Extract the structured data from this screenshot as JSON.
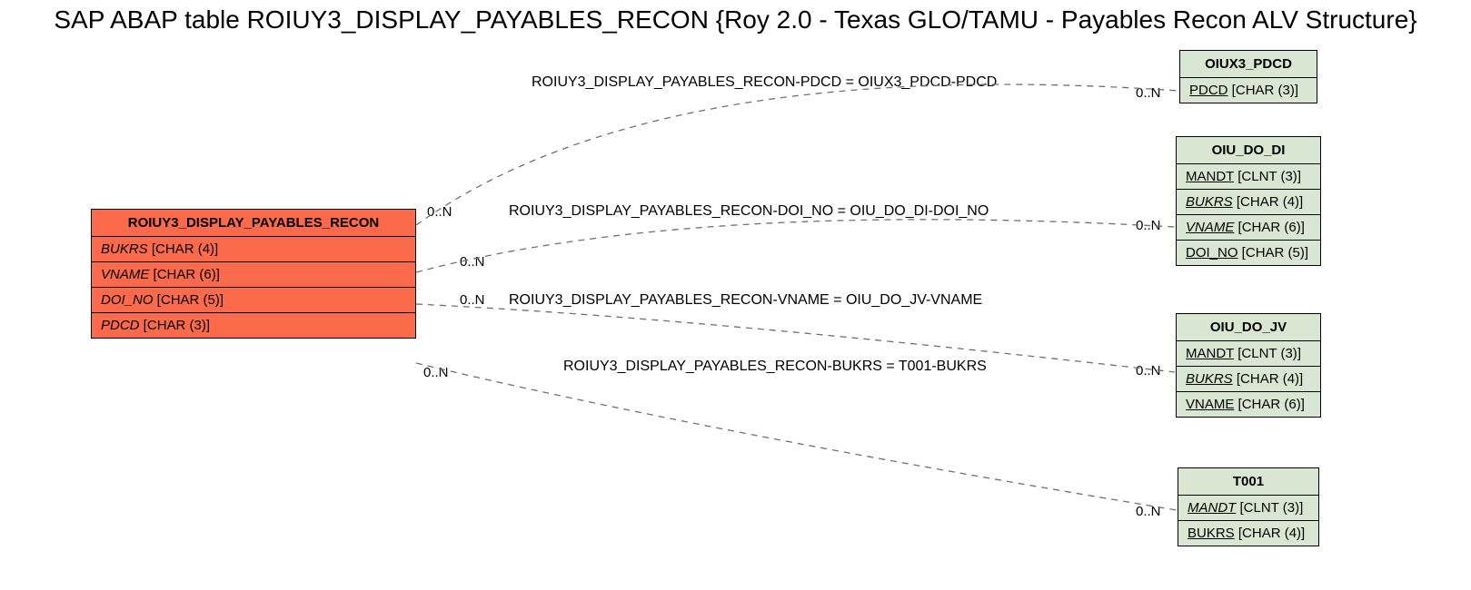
{
  "title": "SAP ABAP table ROIUY3_DISPLAY_PAYABLES_RECON {Roy 2.0 - Texas GLO/TAMU - Payables Recon ALV Structure}",
  "main_table": {
    "name": "ROIUY3_DISPLAY_PAYABLES_RECON",
    "fields": [
      {
        "name": "BUKRS",
        "type": "CHAR (4)",
        "italic": true
      },
      {
        "name": "VNAME",
        "type": "CHAR (6)",
        "italic": true
      },
      {
        "name": "DOI_NO",
        "type": "CHAR (5)",
        "italic": true
      },
      {
        "name": "PDCD",
        "type": "CHAR (3)",
        "italic": true
      }
    ]
  },
  "ref_tables": [
    {
      "id": "oiux3_pdcd",
      "name": "OIUX3_PDCD",
      "fields": [
        {
          "name": "PDCD",
          "type": "CHAR (3)",
          "underline": true
        }
      ]
    },
    {
      "id": "oiu_do_di",
      "name": "OIU_DO_DI",
      "fields": [
        {
          "name": "MANDT",
          "type": "CLNT (3)",
          "underline": true
        },
        {
          "name": "BUKRS",
          "type": "CHAR (4)",
          "underline": true,
          "italic": true
        },
        {
          "name": "VNAME",
          "type": "CHAR (6)",
          "underline": true,
          "italic": true
        },
        {
          "name": "DOI_NO",
          "type": "CHAR (5)",
          "underline": true
        }
      ]
    },
    {
      "id": "oiu_do_jv",
      "name": "OIU_DO_JV",
      "fields": [
        {
          "name": "MANDT",
          "type": "CLNT (3)",
          "underline": true
        },
        {
          "name": "BUKRS",
          "type": "CHAR (4)",
          "underline": true,
          "italic": true
        },
        {
          "name": "VNAME",
          "type": "CHAR (6)",
          "underline": true
        }
      ]
    },
    {
      "id": "t001",
      "name": "T001",
      "fields": [
        {
          "name": "MANDT",
          "type": "CLNT (3)",
          "underline": true,
          "italic": true
        },
        {
          "name": "BUKRS",
          "type": "CHAR (4)",
          "underline": true
        }
      ]
    }
  ],
  "relations": [
    {
      "label": "ROIUY3_DISPLAY_PAYABLES_RECON-PDCD = OIUX3_PDCD-PDCD",
      "left_card": "0..N",
      "right_card": "0..N"
    },
    {
      "label": "ROIUY3_DISPLAY_PAYABLES_RECON-DOI_NO = OIU_DO_DI-DOI_NO",
      "left_card": "0..N",
      "right_card": "0..N"
    },
    {
      "label": "ROIUY3_DISPLAY_PAYABLES_RECON-VNAME = OIU_DO_JV-VNAME",
      "left_card": "0..N",
      "right_card": "0..N"
    },
    {
      "label": "ROIUY3_DISPLAY_PAYABLES_RECON-BUKRS = T001-BUKRS",
      "left_card": "0..N",
      "right_card": "0..N"
    }
  ]
}
